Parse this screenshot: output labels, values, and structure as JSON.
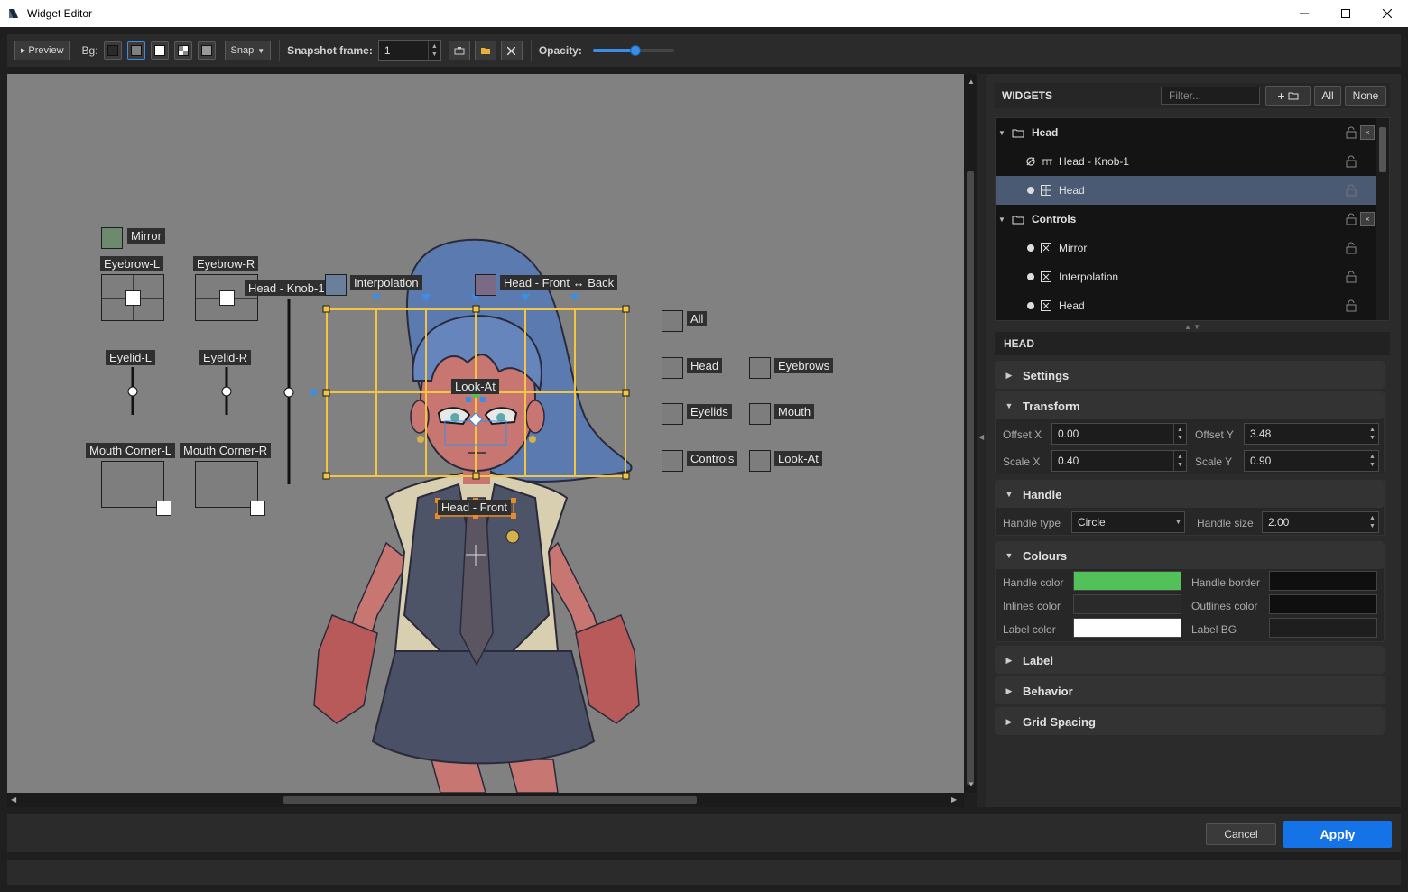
{
  "window": {
    "title": "Widget Editor"
  },
  "toolbar": {
    "preview_label": "Preview",
    "bg_label": "Bg:",
    "snap_label": "Snap",
    "snapshot_label": "Snapshot frame:",
    "snapshot_value": "1",
    "opacity_label": "Opacity:",
    "opacity_value": 0.52
  },
  "canvas": {
    "labels": {
      "mirror": "Mirror",
      "eyebrow_l": "Eyebrow-L",
      "eyebrow_r": "Eyebrow-R",
      "head_knob": "Head - Knob-1",
      "interpolation": "Interpolation",
      "head_front_back": "Head - Front ↔ Back",
      "eyelid_l": "Eyelid-L",
      "eyelid_r": "Eyelid-R",
      "look_at": "Look-At",
      "mouth_corner_l": "Mouth Corner-L",
      "mouth_corner_r": "Mouth Corner-R",
      "head_front": "Head - Front"
    },
    "checkboxes": [
      "All",
      "Head",
      "Eyebrows",
      "Eyelids",
      "Mouth",
      "Controls",
      "Look-At"
    ]
  },
  "widgets_panel": {
    "title": "WIDGETS",
    "filter_placeholder": "Filter...",
    "add_folder": "+",
    "all_btn": "All",
    "none_btn": "None",
    "tree": [
      {
        "label": "Head"
      },
      {
        "label": "Head - Knob-1"
      },
      {
        "label": "Head"
      },
      {
        "label": "Controls"
      },
      {
        "label": "Mirror"
      },
      {
        "label": "Interpolation"
      },
      {
        "label": "Head"
      }
    ]
  },
  "properties": {
    "section_title": "HEAD",
    "settings": "Settings",
    "transform": {
      "title": "Transform",
      "offset_x_label": "Offset X",
      "offset_x": "0.00",
      "offset_y_label": "Offset Y",
      "offset_y": "3.48",
      "scale_x_label": "Scale X",
      "scale_x": "0.40",
      "scale_y_label": "Scale Y",
      "scale_y": "0.90"
    },
    "handle": {
      "title": "Handle",
      "type_label": "Handle type",
      "type_value": "Circle",
      "size_label": "Handle size",
      "size_value": "2.00"
    },
    "colours": {
      "title": "Colours",
      "handle_color_label": "Handle color",
      "handle_color": "#52c15a",
      "handle_border_label": "Handle border",
      "handle_border": "#0f0f0f",
      "inlines_color_label": "Inlines color",
      "inlines_color": "#2a2a2a",
      "outlines_color_label": "Outlines color",
      "outlines_color": "#0f0f0f",
      "label_color_label": "Label color",
      "label_color": "#ffffff",
      "label_bg_label": "Label BG",
      "label_bg": "#1e1e1e"
    },
    "label": "Label",
    "behavior": "Behavior",
    "grid_spacing": "Grid Spacing"
  },
  "footer": {
    "cancel": "Cancel",
    "apply": "Apply"
  },
  "colors": {
    "accent": "#1473e6",
    "grid": "#f2c542",
    "selection": "#4a5a72"
  }
}
